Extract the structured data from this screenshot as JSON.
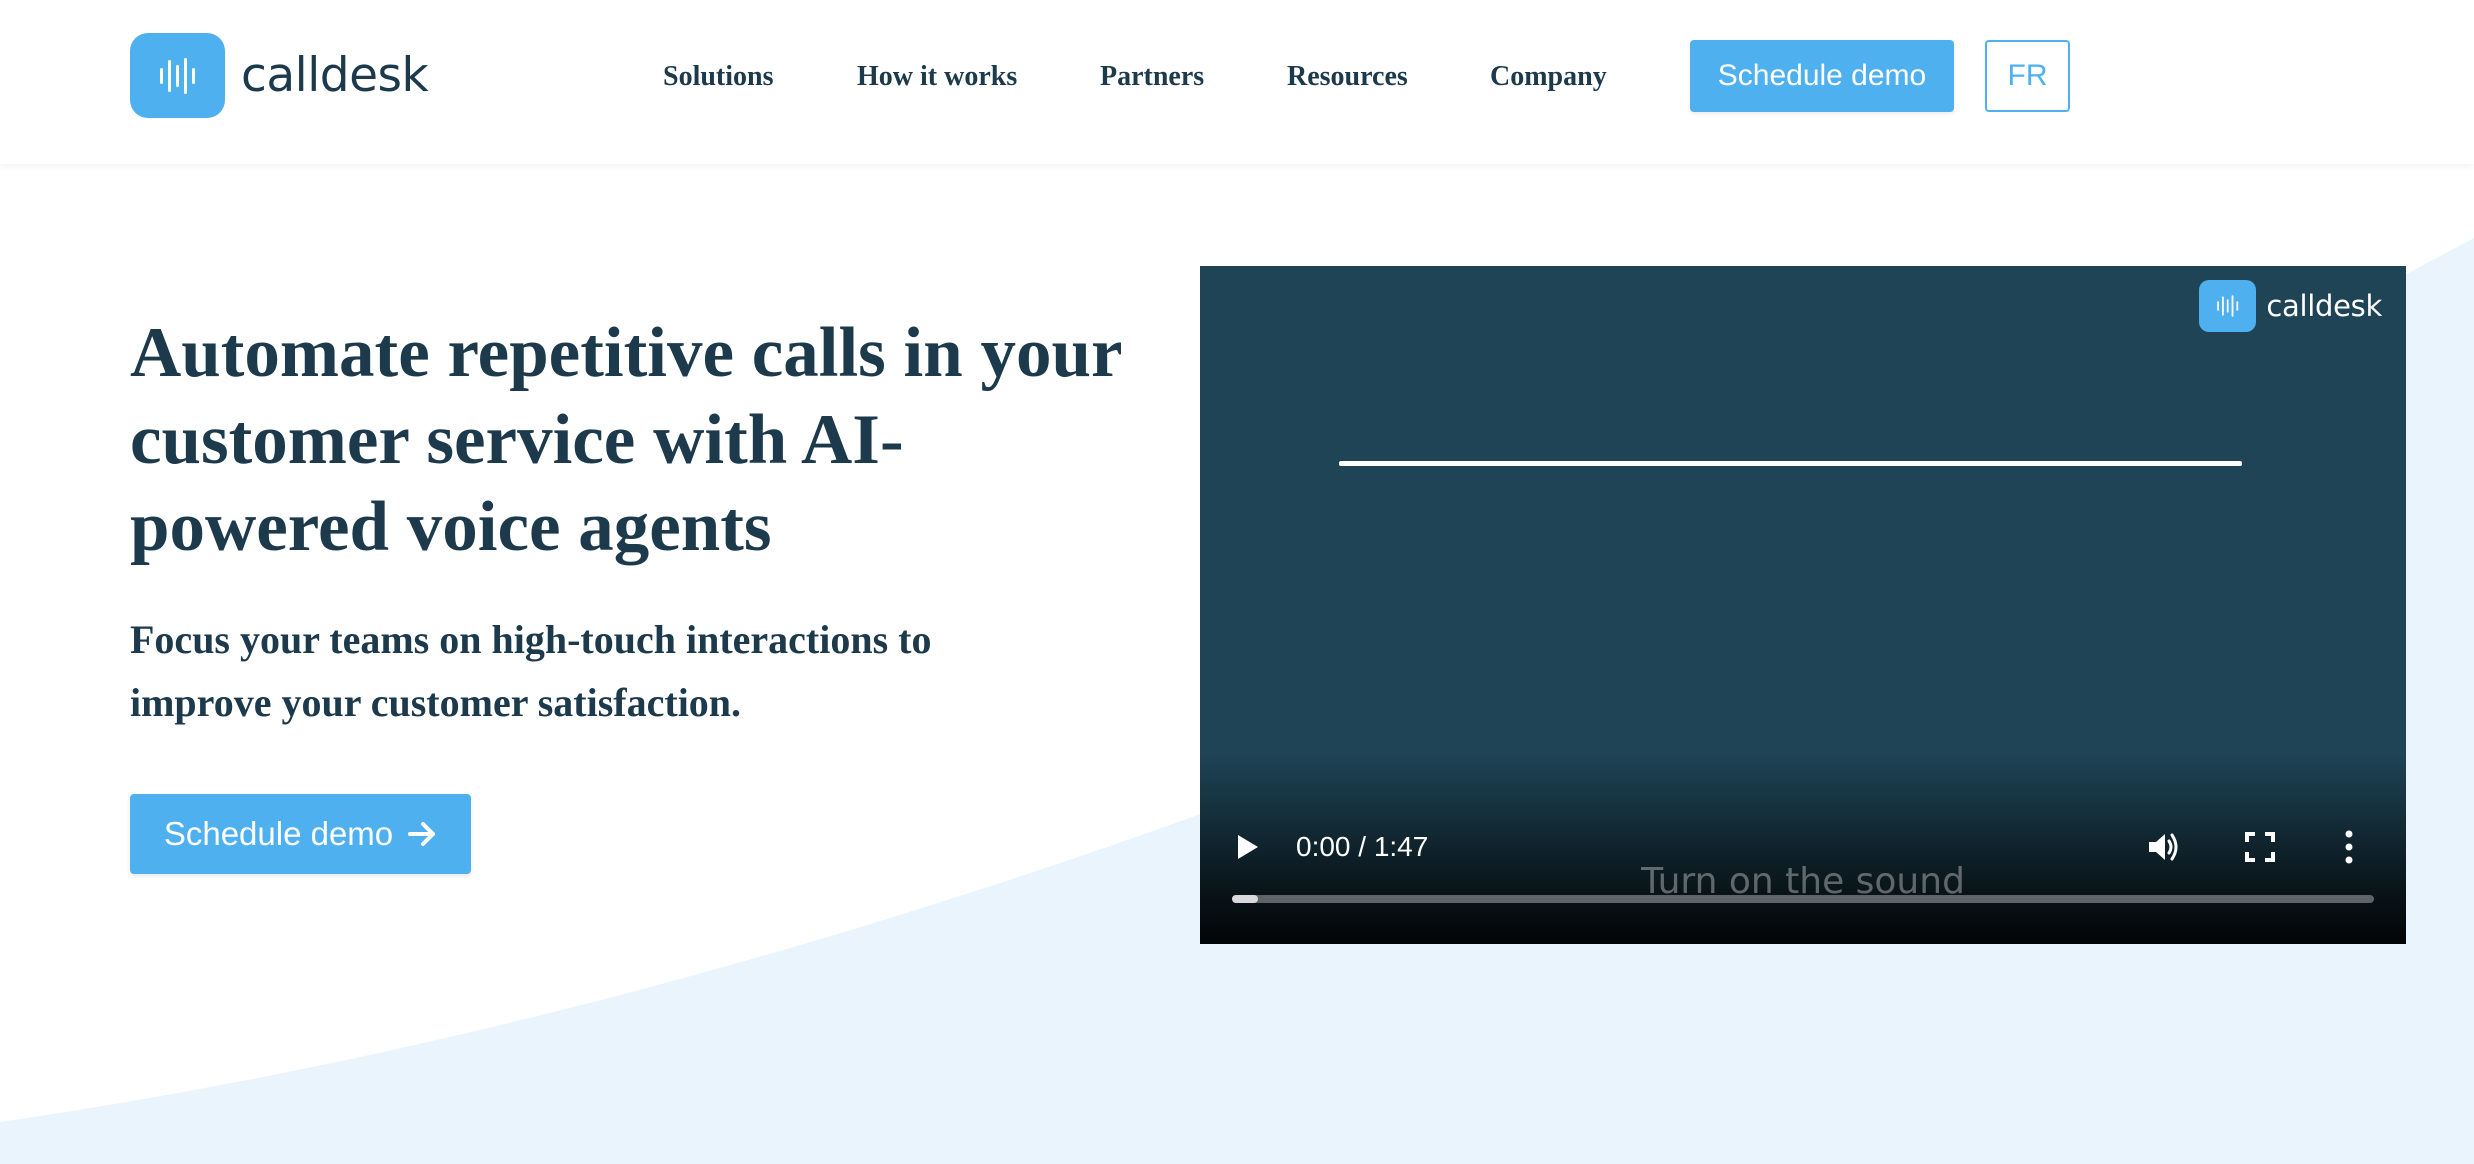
{
  "brand": {
    "name": "calldesk",
    "accent_color": "#4fb0ef",
    "text_color": "#1c3a4c"
  },
  "header": {
    "nav": [
      {
        "label": "Solutions"
      },
      {
        "label": "How it works"
      },
      {
        "label": "Partners"
      },
      {
        "label": "Resources"
      },
      {
        "label": "Company"
      }
    ],
    "cta_label": "Schedule demo",
    "lang_label": "FR"
  },
  "hero": {
    "title": "Automate repetitive calls in your customer service with AI-powered voice agents",
    "subtitle": "Focus your teams on high-touch interactions to improve your customer satisfaction.",
    "cta_label": "Schedule demo",
    "cta_icon": "arrow-right-icon"
  },
  "video": {
    "logo_text": "calldesk",
    "caption": "Turn on the sound",
    "time": "0:00 / 1:47",
    "progress_fraction": 0.02,
    "background_color": "#1e4456",
    "icons": [
      "play-icon",
      "volume-icon",
      "fullscreen-icon",
      "more-options-icon"
    ]
  }
}
